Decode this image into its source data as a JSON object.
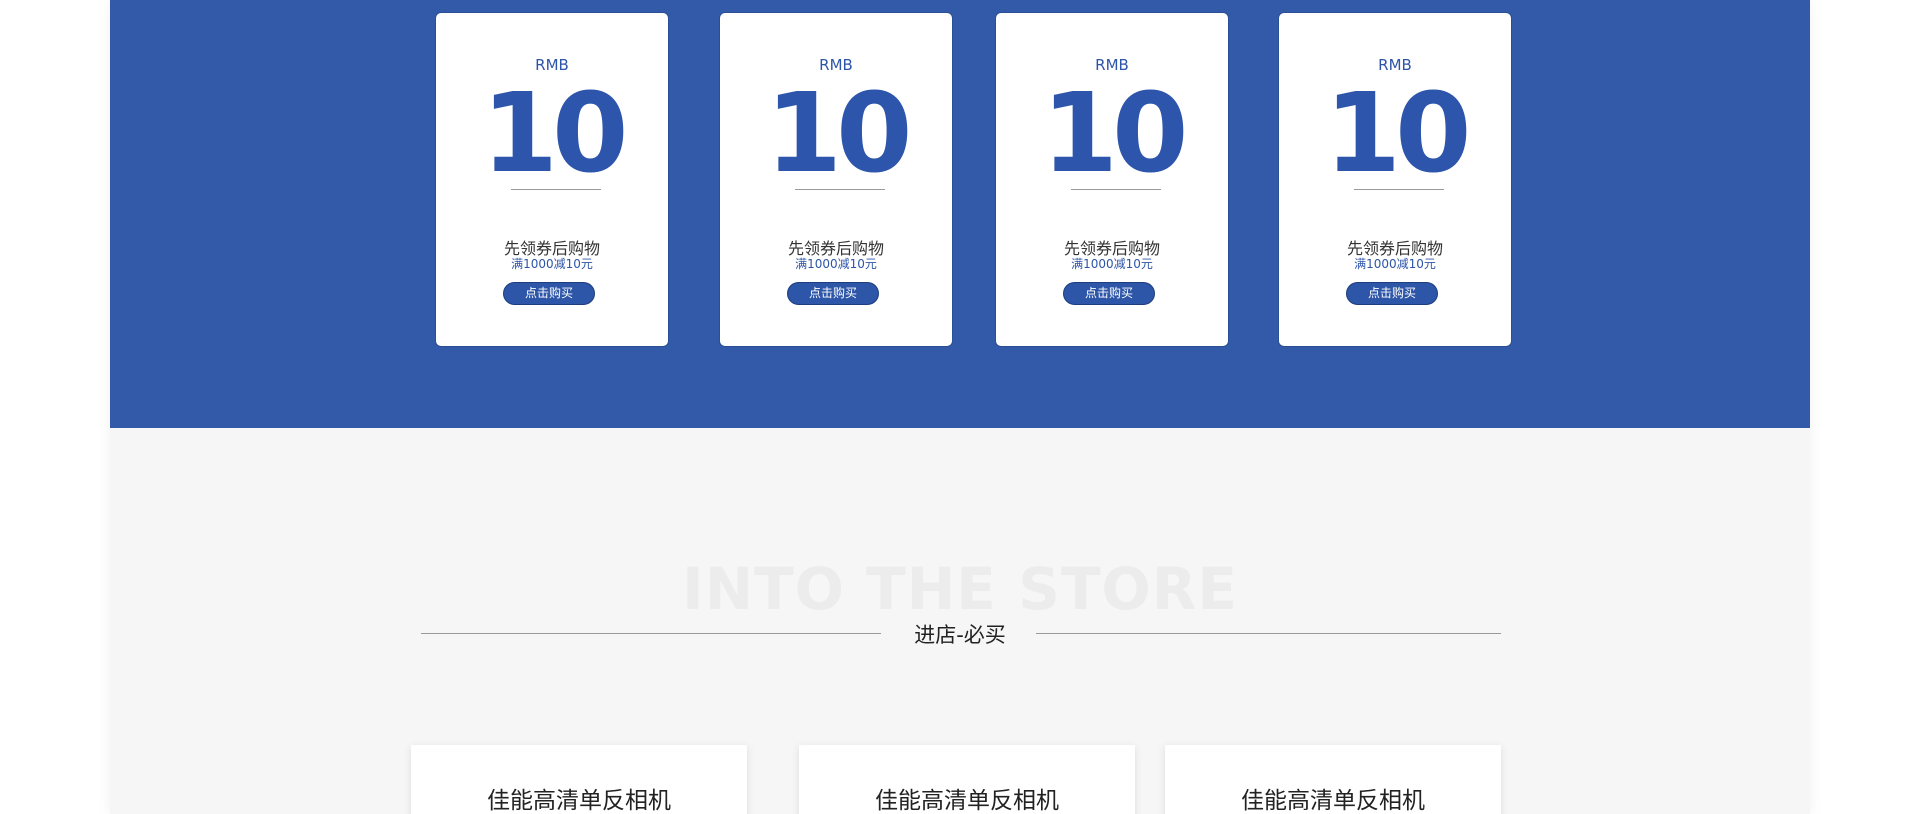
{
  "colors": {
    "accent": "#325aa8",
    "accent_dark": "#2c55ab",
    "section_bg": "#f6f6f6"
  },
  "coupons": [
    {
      "currency": "RMB",
      "amount": "10",
      "title": "先领券后购物",
      "condition": "满1000减10元",
      "button": "点击购买"
    },
    {
      "currency": "RMB",
      "amount": "10",
      "title": "先领券后购物",
      "condition": "满1000减10元",
      "button": "点击购买"
    },
    {
      "currency": "RMB",
      "amount": "10",
      "title": "先领券后购物",
      "condition": "满1000减10元",
      "button": "点击购买"
    },
    {
      "currency": "RMB",
      "amount": "10",
      "title": "先领券后购物",
      "condition": "满1000减10元",
      "button": "点击购买"
    }
  ],
  "section": {
    "ghost_title": "INTO THE STORE",
    "title": "进店-必买"
  },
  "products": [
    {
      "title": "佳能高清单反相机"
    },
    {
      "title": "佳能高清单反相机"
    },
    {
      "title": "佳能高清单反相机"
    }
  ]
}
